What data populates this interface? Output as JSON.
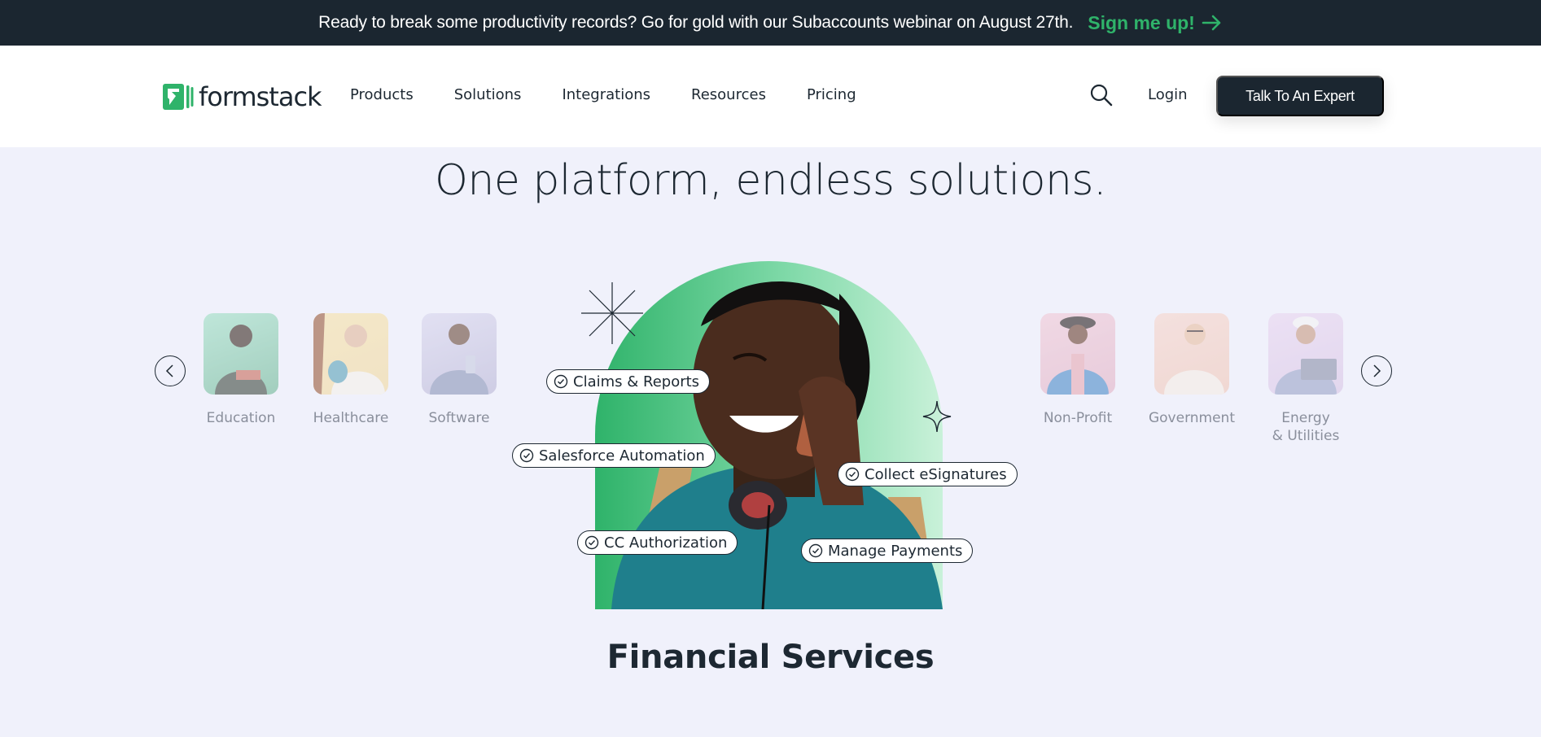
{
  "banner": {
    "text": "Ready to break some productivity records? Go for gold with our Subaccounts webinar on August 27th.",
    "link_label": "Sign me up!",
    "link_icon": "arrow-right-icon",
    "link_color": "#2fb36a"
  },
  "header": {
    "logo_text": "formstack",
    "logo_icon": "formstack-logo-icon",
    "nav": [
      {
        "label": "Products"
      },
      {
        "label": "Solutions"
      },
      {
        "label": "Integrations"
      },
      {
        "label": "Resources"
      },
      {
        "label": "Pricing"
      }
    ],
    "search_icon": "search-icon",
    "login_label": "Login",
    "cta_label": "Talk To An Expert"
  },
  "hero": {
    "title": "One platform, endless solutions.",
    "industries_left": [
      {
        "label": "Education"
      },
      {
        "label": "Healthcare"
      },
      {
        "label": "Software"
      }
    ],
    "industries_right": [
      {
        "label": "Non-Profit"
      },
      {
        "label": "Government"
      },
      {
        "label": "Energy\n& Utilities",
        "line1": "Energy",
        "line2": "& Utilities"
      }
    ],
    "prev_icon": "chevron-left-icon",
    "next_icon": "chevron-right-icon",
    "features": [
      {
        "label": "Claims & Reports"
      },
      {
        "label": "Salesforce Automation"
      },
      {
        "label": "Collect eSignatures"
      },
      {
        "label": "CC Authorization"
      },
      {
        "label": "Manage Payments"
      }
    ],
    "selected_industry": "Financial Services"
  },
  "colors": {
    "brand_green": "#2fb36a",
    "dark": "#1b2630",
    "background": "#f0f1fb"
  }
}
